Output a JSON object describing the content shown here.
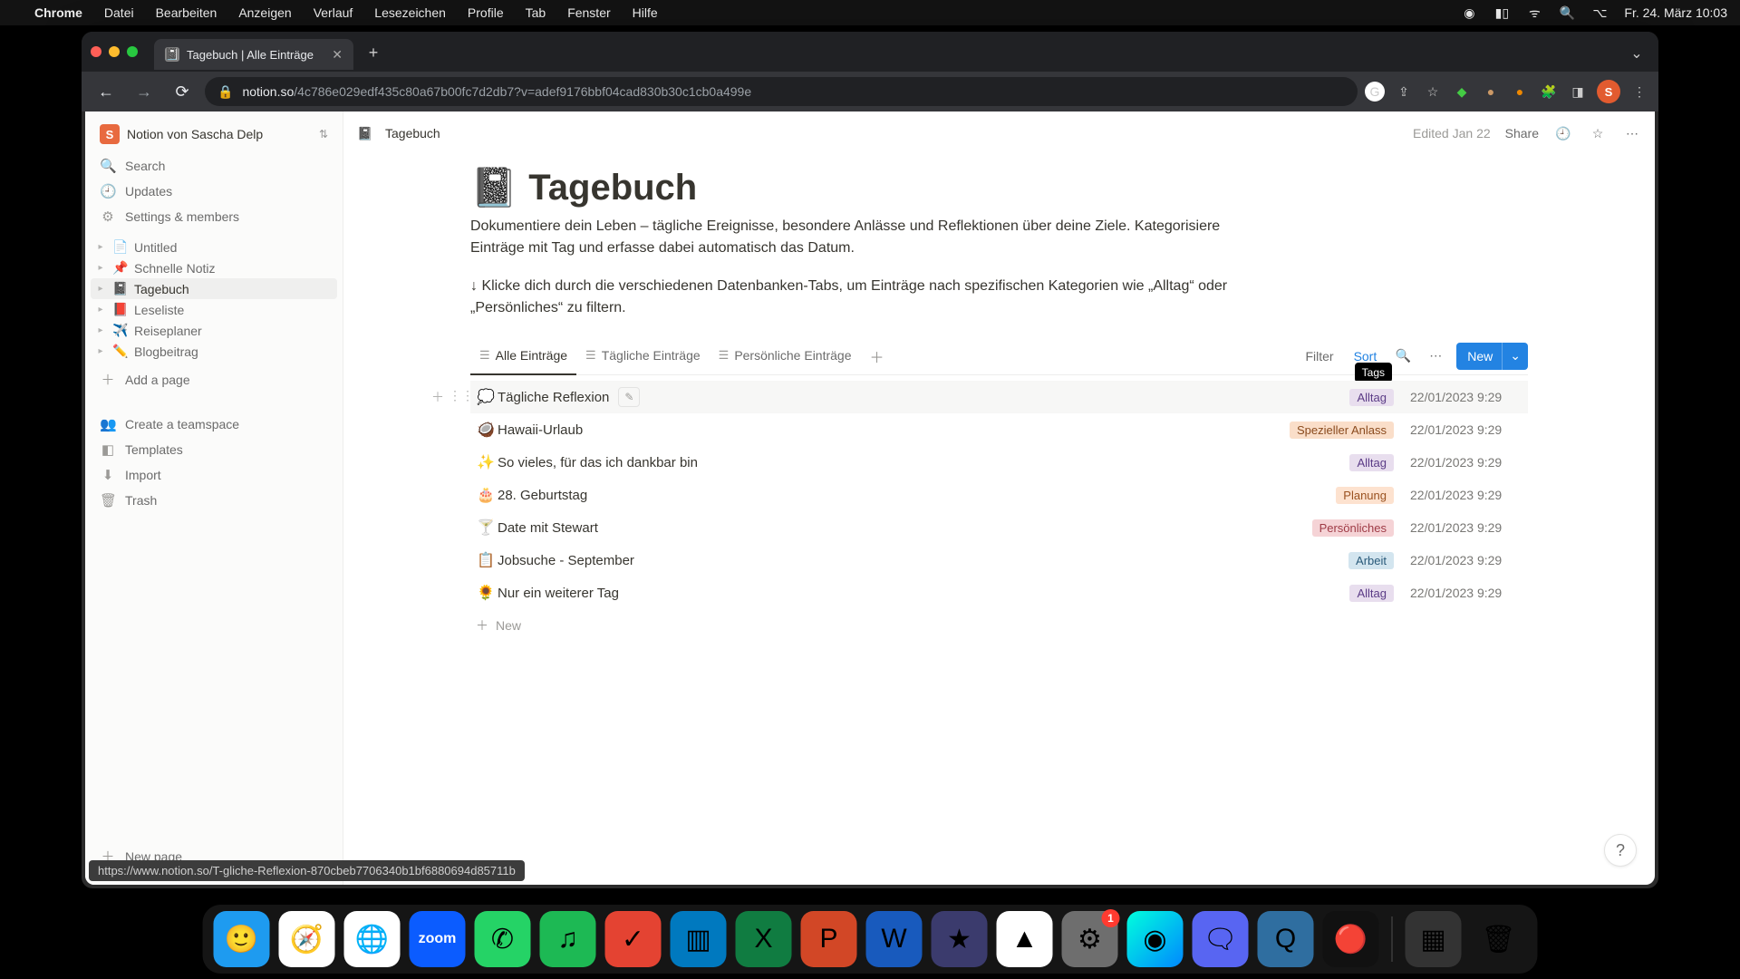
{
  "menubar": {
    "app": "Chrome",
    "items": [
      "Datei",
      "Bearbeiten",
      "Anzeigen",
      "Verlauf",
      "Lesezeichen",
      "Profile",
      "Tab",
      "Fenster",
      "Hilfe"
    ],
    "clock": "Fr. 24. März  10:03"
  },
  "browser": {
    "tab_title": "Tagebuch | Alle Einträge",
    "url_domain": "notion.so",
    "url_path": "/4c786e029edf435c80a67b00fc7d2db7?v=adef9176bbf04cad830b30c1cb0a499e",
    "avatar_initial": "S",
    "hover_url": "https://www.notion.so/T-gliche-Reflexion-870cbeb7706340b1bf6880694d85711b"
  },
  "workspace": {
    "initial": "S",
    "name": "Notion von Sascha Delp"
  },
  "sidebar_top": {
    "search": "Search",
    "updates": "Updates",
    "settings": "Settings & members"
  },
  "pages": [
    {
      "emoji": "📄",
      "label": "Untitled",
      "active": false
    },
    {
      "emoji": "📌",
      "label": "Schnelle Notiz",
      "active": false
    },
    {
      "emoji": "📓",
      "label": "Tagebuch",
      "active": true
    },
    {
      "emoji": "📕",
      "label": "Leseliste",
      "active": false
    },
    {
      "emoji": "✈️",
      "label": "Reiseplaner",
      "active": false
    },
    {
      "emoji": "✏️",
      "label": "Blogbeitrag",
      "active": false
    }
  ],
  "sidebar_more": {
    "add_page": "Add a page",
    "teamspace": "Create a teamspace",
    "templates": "Templates",
    "import": "Import",
    "trash": "Trash",
    "new_page": "New page"
  },
  "topbar": {
    "breadcrumb_emoji": "📓",
    "breadcrumb": "Tagebuch",
    "edited": "Edited Jan 22",
    "share": "Share"
  },
  "page": {
    "emoji": "📓",
    "title": "Tagebuch",
    "desc": "Dokumentiere dein Leben – tägliche Ereignisse, besondere Anlässe und Reflektionen über deine Ziele. Kategorisiere Einträge mit Tag und erfasse dabei automatisch das Datum.",
    "hint": "↓ Klicke dich durch die verschiedenen Datenbanken-Tabs, um Einträge nach spezifischen Kategorien wie „Alltag“ oder „Persönliches“ zu filtern."
  },
  "db": {
    "tabs": [
      {
        "label": "Alle Einträge",
        "active": true
      },
      {
        "label": "Tägliche Einträge",
        "active": false
      },
      {
        "label": "Persönliche Einträge",
        "active": false
      }
    ],
    "filter": "Filter",
    "sort": "Sort",
    "new": "New",
    "tooltip": "Tags",
    "add_row": "New"
  },
  "rows": [
    {
      "emoji": "💭",
      "title": "Tägliche Reflexion",
      "tag": "Alltag",
      "tagClass": "purple",
      "date": "22/01/2023 9:29",
      "hovered": true,
      "edit": true
    },
    {
      "emoji": "🥥",
      "title": "Hawaii-Urlaub",
      "tag": "Spezieller Anlass",
      "tagClass": "orange",
      "date": "22/01/2023 9:29"
    },
    {
      "emoji": "✨",
      "title": "So vieles, für das ich dankbar bin",
      "tag": "Alltag",
      "tagClass": "purple",
      "date": "22/01/2023 9:29"
    },
    {
      "emoji": "🎂",
      "title": "28. Geburtstag",
      "tag": "Planung",
      "tagClass": "orange2",
      "date": "22/01/2023 9:29"
    },
    {
      "emoji": "🍸",
      "title": "Date mit Stewart",
      "tag": "Persönliches",
      "tagClass": "pink",
      "date": "22/01/2023 9:29"
    },
    {
      "emoji": "📋",
      "title": "Jobsuche - September",
      "tag": "Arbeit",
      "tagClass": "blue",
      "date": "22/01/2023 9:29"
    },
    {
      "emoji": "🌻",
      "title": "Nur ein weiterer Tag",
      "tag": "Alltag",
      "tagClass": "purple",
      "date": "22/01/2023 9:29"
    }
  ],
  "dock": {
    "items": [
      {
        "name": "finder",
        "bg": "#1e9bf0",
        "glyph": "🙂"
      },
      {
        "name": "safari",
        "bg": "#ffffff",
        "glyph": "🧭"
      },
      {
        "name": "chrome",
        "bg": "#ffffff",
        "glyph": "🌐"
      },
      {
        "name": "zoom",
        "bg": "#0b5cff",
        "glyph": "zoom",
        "text": true
      },
      {
        "name": "whatsapp",
        "bg": "#25d366",
        "glyph": "✆"
      },
      {
        "name": "spotify",
        "bg": "#1db954",
        "glyph": "♫"
      },
      {
        "name": "todoist",
        "bg": "#e44332",
        "glyph": "✓"
      },
      {
        "name": "trello",
        "bg": "#0079bf",
        "glyph": "▥"
      },
      {
        "name": "excel",
        "bg": "#107c41",
        "glyph": "X"
      },
      {
        "name": "powerpoint",
        "bg": "#d24726",
        "glyph": "P"
      },
      {
        "name": "word",
        "bg": "#185abd",
        "glyph": "W"
      },
      {
        "name": "imovie",
        "bg": "#3b3b6d",
        "glyph": "★"
      },
      {
        "name": "drive",
        "bg": "#ffffff",
        "glyph": "▲"
      },
      {
        "name": "settings",
        "bg": "#6e6e6e",
        "glyph": "⚙",
        "badge": "1"
      },
      {
        "name": "siri",
        "bg": "linear-gradient(135deg,#0fd,#08f)",
        "glyph": "◉"
      },
      {
        "name": "discord",
        "bg": "#5865f2",
        "glyph": "🗨"
      },
      {
        "name": "quicktime",
        "bg": "#2f6ea0",
        "glyph": "Q"
      },
      {
        "name": "voice-memos",
        "bg": "#111",
        "glyph": "🔴"
      }
    ],
    "right": [
      {
        "name": "mission-control",
        "bg": "#333",
        "glyph": "▦"
      },
      {
        "name": "trash",
        "bg": "transparent",
        "glyph": "🗑"
      }
    ]
  }
}
